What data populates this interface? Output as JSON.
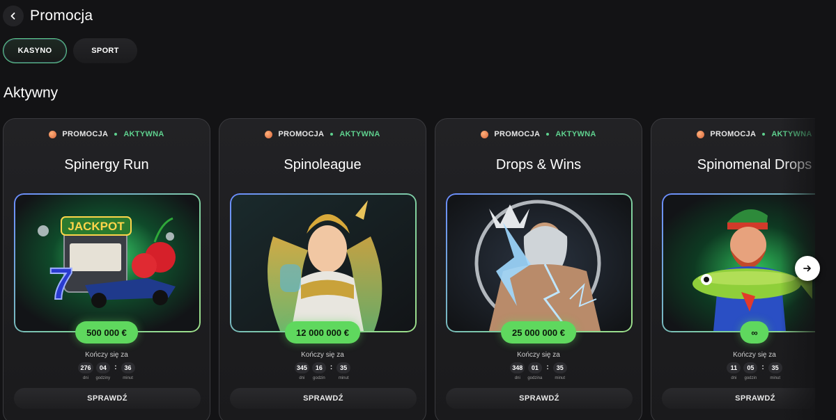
{
  "header": {
    "title": "Promocja",
    "back_icon": "chevron-left-icon"
  },
  "tabs": [
    {
      "label": "KASYNO",
      "active": true
    },
    {
      "label": "SPORT",
      "active": false
    }
  ],
  "section": {
    "title": "Aktywny"
  },
  "colors": {
    "accent_green": "#5fd85e",
    "background": "#131315",
    "card_bg": "#1e1e21"
  },
  "cards": [
    {
      "tag": "PROMOCJA",
      "status": "AKTYWNA",
      "title": "Spinergy Run",
      "prize": "500 000 €",
      "ends_label": "Kończy się za",
      "countdown": [
        {
          "value": "276",
          "label": "dni"
        },
        {
          "value": "04",
          "label": "godziny"
        },
        {
          "value": "36",
          "label": "minut"
        }
      ],
      "button": "SPRAWDŹ",
      "image": "jackpot-slot-race-car"
    },
    {
      "tag": "PROMOCJA",
      "status": "AKTYWNA",
      "title": "Spinoleague",
      "prize": "12 000 000 €",
      "ends_label": "Kończy się za",
      "countdown": [
        {
          "value": "345",
          "label": "dni"
        },
        {
          "value": "16",
          "label": "godzin"
        },
        {
          "value": "35",
          "label": "minut"
        }
      ],
      "button": "SPRAWDŹ",
      "image": "goddess-warrior"
    },
    {
      "tag": "PROMOCJA",
      "status": "AKTYWNA",
      "title": "Drops & Wins",
      "prize": "25 000 000 €",
      "ends_label": "Kończy się za",
      "countdown": [
        {
          "value": "348",
          "label": "dni"
        },
        {
          "value": "01",
          "label": "godzina"
        },
        {
          "value": "35",
          "label": "minut"
        }
      ],
      "button": "SPRAWDŹ",
      "image": "zeus-lightning"
    },
    {
      "tag": "PROMOCJA",
      "status": "AKTYWNA",
      "title": "Spinomenal Drops",
      "prize": "∞",
      "ends_label": "Kończy się za",
      "countdown": [
        {
          "value": "11",
          "label": "dni"
        },
        {
          "value": "05",
          "label": "godzin"
        },
        {
          "value": "35",
          "label": "minut"
        }
      ],
      "button": "SPRAWDŹ",
      "image": "fisherman-with-fish"
    }
  ],
  "carousel": {
    "next_icon": "arrow-right-icon"
  }
}
